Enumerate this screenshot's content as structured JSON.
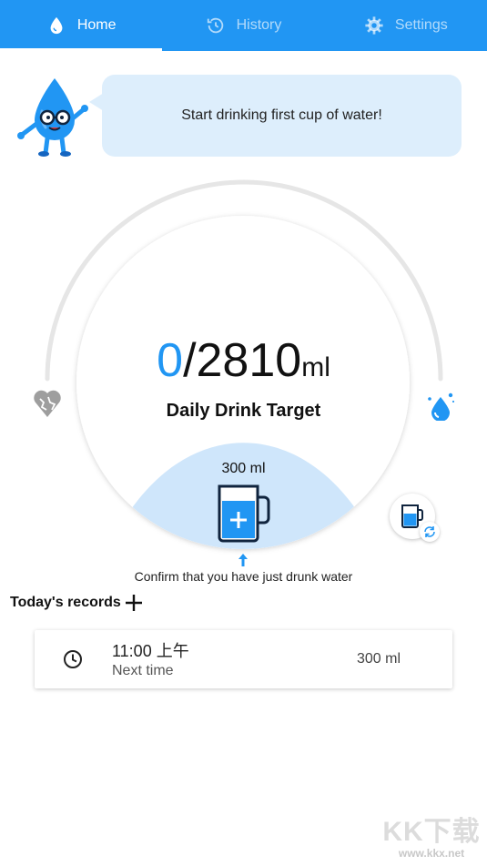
{
  "tabs": [
    {
      "label": "Home",
      "active": true,
      "icon": "water-drop-icon"
    },
    {
      "label": "History",
      "active": false,
      "icon": "history-icon"
    },
    {
      "label": "Settings",
      "active": false,
      "icon": "gear-icon"
    }
  ],
  "colors": {
    "accent": "#2196f3",
    "bubble": "#ddeefc",
    "cup_fill": "#cfe6fb"
  },
  "mascot": {
    "bubble_text": "Start drinking first cup of water!"
  },
  "gauge": {
    "current": "0",
    "separator": "/",
    "target": "2810",
    "unit": "ml",
    "label": "Daily Drink Target",
    "cup_amount": "300 ml",
    "confirm_text": "Confirm that you have just drunk water",
    "progress_fraction": 0
  },
  "records": {
    "title": "Today's records",
    "items": [
      {
        "time": "11:00 上午",
        "sub": "Next time",
        "amount": "300 ml"
      }
    ]
  },
  "watermark": {
    "logo": "KK下载",
    "url": "www.kkx.net"
  }
}
